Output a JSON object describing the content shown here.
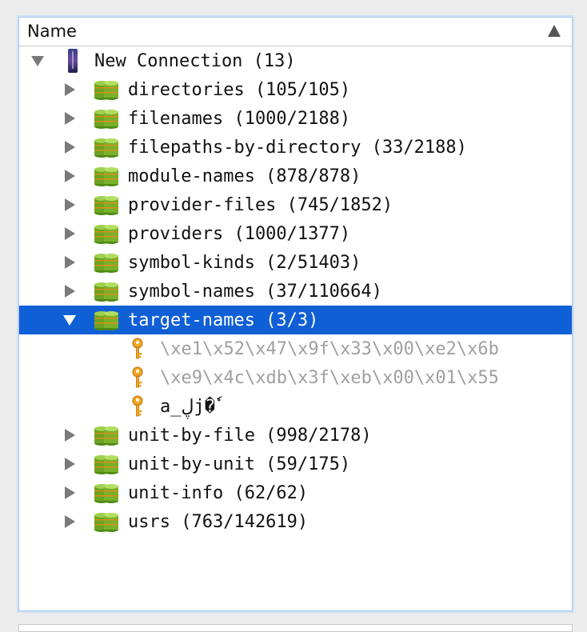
{
  "header": {
    "column_label": "Name"
  },
  "connection": {
    "label": "New Connection (13)"
  },
  "tables_before": [
    {
      "label": "directories (105/105)"
    },
    {
      "label": "filenames (1000/2188)"
    },
    {
      "label": "filepaths-by-directory (33/2188)"
    },
    {
      "label": "module-names (878/878)"
    },
    {
      "label": "provider-files (745/1852)"
    },
    {
      "label": "providers (1000/1377)"
    },
    {
      "label": "symbol-kinds (2/51403)"
    },
    {
      "label": "symbol-names (37/110664)"
    }
  ],
  "selected_table": {
    "label": "target-names (3/3)"
  },
  "keys": [
    {
      "label": "\\xe1\\x52\\x47\\x9f\\x33\\x00\\xe2\\x6b",
      "dimmed": true
    },
    {
      "label": "\\xe9\\x4c\\xdb\\x3f\\xeb\\x00\\x01\\x55",
      "dimmed": true
    },
    {
      "label": "a_ڸj�ٗ",
      "dimmed": false
    }
  ],
  "tables_after": [
    {
      "label": "unit-by-file (998/2178)"
    },
    {
      "label": "unit-by-unit (59/175)"
    },
    {
      "label": "unit-info (62/62)"
    },
    {
      "label": "usrs (763/142619)"
    }
  ],
  "icons": {
    "connection": "database-connection-icon",
    "table": "table-cylinder-icon",
    "key": "key-icon",
    "expand": "disclosure-triangle-icon",
    "sort": "sort-ascending-icon"
  },
  "colors": {
    "selection": "#0f5fd6",
    "table_icon_green": "#6aa321",
    "table_icon_orange": "#e08a1e",
    "key_icon": "#f0a520"
  }
}
